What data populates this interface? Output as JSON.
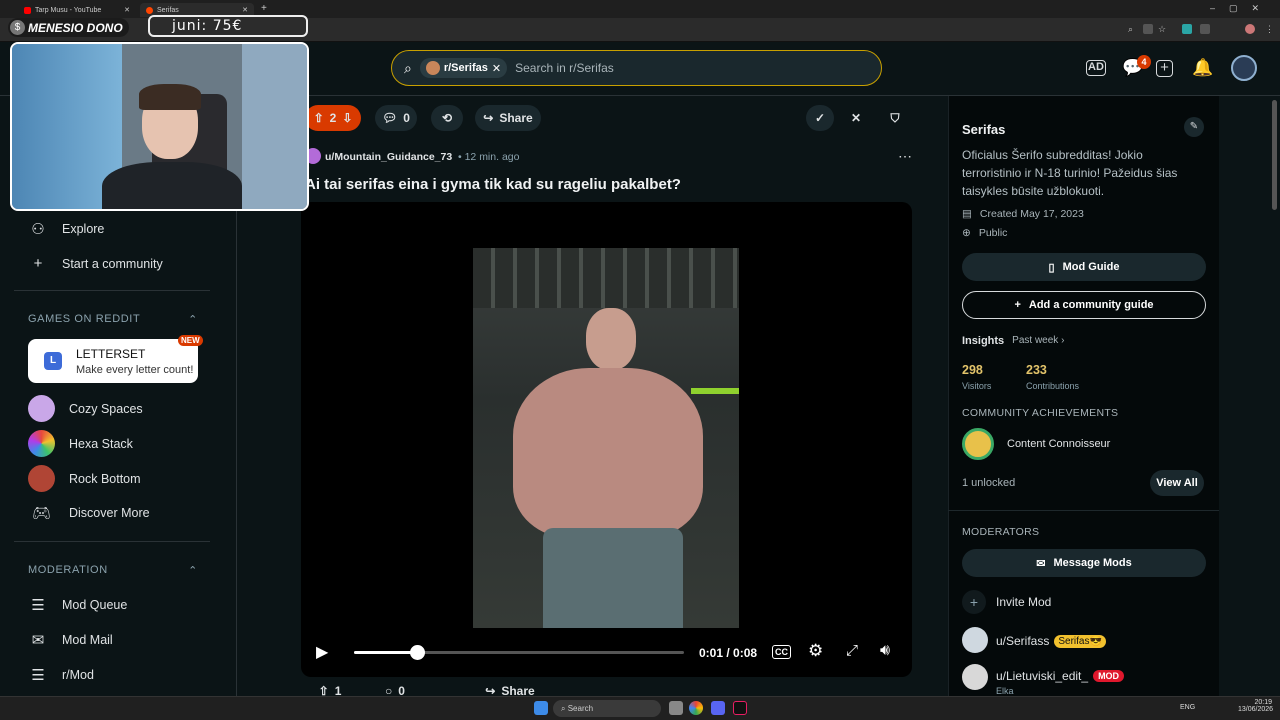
{
  "browser": {
    "tabs": [
      {
        "label": "Tarp Musu - YouTube",
        "color": "#ff0000"
      },
      {
        "label": "Serifas",
        "color": "#ff4500"
      }
    ],
    "new_tab": "+"
  },
  "overlay": {
    "tag": "MENESIO DONO",
    "coin": "$",
    "amount": "juni: 75€"
  },
  "header": {
    "search_chip": "r/Serifas",
    "search_placeholder": "Search in r/Serifas",
    "chat_badge": "4",
    "icons": [
      "ad-icon",
      "chat-icon",
      "create-icon",
      "notification-icon",
      "avatar"
    ]
  },
  "sidebar": {
    "items_top": [
      {
        "label": "Explore",
        "icon": "explore-icon"
      },
      {
        "label": "Start a community",
        "icon": "plus-icon"
      }
    ],
    "games_header": "GAMES ON REDDIT",
    "featured_game": {
      "title": "LETTERSET",
      "subtitle": "Make every letter count!",
      "badge": "NEW",
      "icon_letter": "L"
    },
    "games": [
      {
        "label": "Cozy Spaces",
        "color": "#c9a7e8"
      },
      {
        "label": "Hexa Stack",
        "color": "#e8483d"
      },
      {
        "label": "Rock Bottom",
        "color": "#b04535"
      },
      {
        "label": "Discover More",
        "color": "#d7dadc"
      }
    ],
    "moderation_header": "MODERATION",
    "moderation": [
      {
        "label": "Mod Queue"
      },
      {
        "label": "Mod Mail"
      },
      {
        "label": "r/Mod"
      }
    ]
  },
  "post": {
    "votes": "2",
    "comments": "0",
    "share": "Share",
    "author": "u/Mountain_Guidance_73",
    "time": "• 12 min. ago",
    "title": "Ai tai serifas eina i gyma tik kad su rageliu pakalbet?",
    "video_time": "0:01 / 0:08",
    "progress": 0.19
  },
  "next_post": {
    "votes": "1",
    "comments": "0",
    "share": "Share"
  },
  "community": {
    "name": "Serifas",
    "description": "Oficialus Šerifo subredditas! Jokio terroristinio ir N-18 turinio! Pažeidus šias taisykles būsite užblokuoti.",
    "created": "Created May 17, 2023",
    "visibility": "Public",
    "mod_guide": "Mod Guide",
    "add_guide": "Add a community guide",
    "insights_label": "Insights",
    "insights_period": "Past week ›",
    "visitors_value": "298",
    "visitors_label": "Visitors",
    "contributions_value": "233",
    "contributions_label": "Contributions",
    "achievements_header": "COMMUNITY ACHIEVEMENTS",
    "achievement": "Content Connoisseur",
    "unlocked": "1 unlocked",
    "view_all": "View All",
    "moderators_header": "MODERATORS",
    "message_mods": "Message Mods",
    "invite_mod": "Invite Mod",
    "mods": [
      {
        "name": "u/Serifass",
        "flair": "Serifas😎",
        "flair_color": "#f2c12e",
        "sub": ""
      },
      {
        "name": "u/Lietuviski_edit_",
        "flair": "MOD",
        "flair_color": "#e0182d",
        "sub": "Elka"
      }
    ]
  },
  "taskbar": {
    "search": "Search",
    "lang": "ENG",
    "time": "20:19",
    "date": "13/06/2026"
  }
}
